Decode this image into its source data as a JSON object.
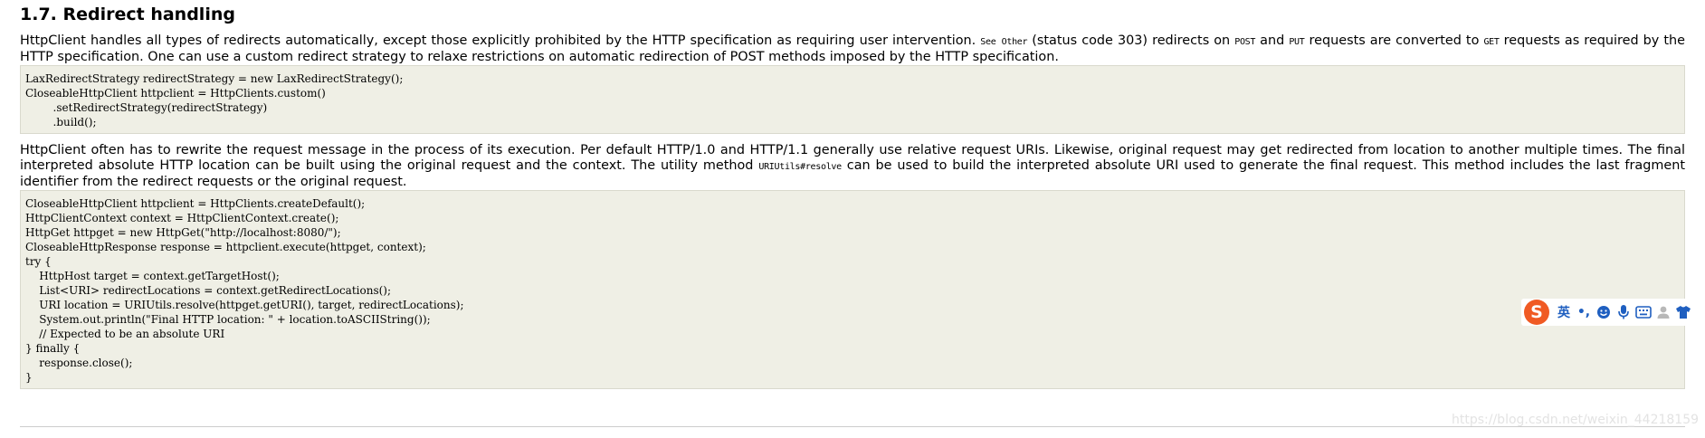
{
  "section": {
    "title": "1.7. Redirect handling"
  },
  "para1": {
    "text_a": "HttpClient handles all types of redirects automatically, except those explicitly prohibited by the HTTP specification as requiring user intervention. ",
    "code_see_other": "See Other",
    "text_b": " (status code 303) redirects on ",
    "code_post": "POST",
    "text_c": " and ",
    "code_put": "PUT",
    "text_d": " requests are converted to ",
    "code_get": "GET",
    "text_e": " requests as required by the HTTP specification. One can use a custom redirect strategy to relaxe restrictions on automatic redirection of POST methods imposed by the HTTP specification."
  },
  "code1": {
    "lines": [
      "LaxRedirectStrategy redirectStrategy = new LaxRedirectStrategy();",
      "CloseableHttpClient httpclient = HttpClients.custom()",
      "        .setRedirectStrategy(redirectStrategy)",
      "        .build();"
    ]
  },
  "para2": {
    "text_a": "HttpClient often has to rewrite the request message in the process of its execution. Per default HTTP/1.0 and HTTP/1.1 generally use relative request URIs. Likewise, original request may get redirected from location to another multiple times. The final interpreted absolute HTTP location can be built using the original request and the context. The utility method ",
    "code_method": "URIUtils#resolve",
    "text_b": " can be used to build the interpreted absolute URI used to generate the final request. This method includes the last fragment identifier from the redirect requests or the original request."
  },
  "code2": {
    "lines": [
      "CloseableHttpClient httpclient = HttpClients.createDefault();",
      "HttpClientContext context = HttpClientContext.create();",
      "HttpGet httpget = new HttpGet(\"http://localhost:8080/\");",
      "CloseableHttpResponse response = httpclient.execute(httpget, context);",
      "try {",
      "    HttpHost target = context.getTargetHost();",
      "    List<URI> redirectLocations = context.getRedirectLocations();",
      "    URI location = URIUtils.resolve(httpget.getURI(), target, redirectLocations);",
      "    System.out.println(\"Final HTTP location: \" + location.toASCIIString());",
      "    // Expected to be an absolute URI",
      "} finally {",
      "    response.close();",
      "}"
    ]
  },
  "ime_toolbar": {
    "logo_letter": "S",
    "mode_label": "英",
    "punct_label": "•,",
    "icons": [
      "emoji-icon",
      "microphone-icon",
      "keyboard-icon",
      "user-icon",
      "shirt-icon"
    ],
    "brand_color": "#f05a23",
    "icon_color": "#1f5fc0"
  },
  "watermark": {
    "text": "https://blog.csdn.net/weixin_44218159"
  }
}
